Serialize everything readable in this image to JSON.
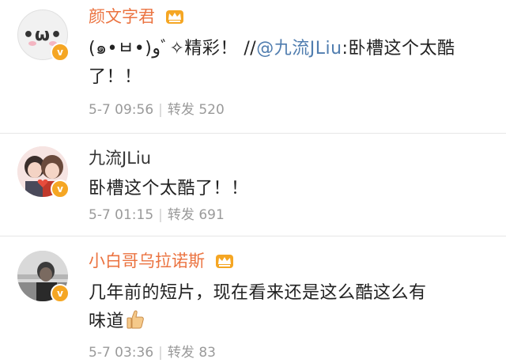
{
  "comments": [
    {
      "username": "颜文字君",
      "text_prefix": "(๑•ㅂ•)وﾞ✧精彩！ //",
      "mention": "@九流JLiu",
      "text_suffix": ":卧槽这个太酷了！！",
      "date": "5-7 09:56",
      "repost_label": "转发",
      "repost_count": "520",
      "avatar_text": "•ω•"
    },
    {
      "username": "九流JLiu",
      "text": "卧槽这个太酷了！！",
      "date": "5-7 01:15",
      "repost_label": "转发",
      "repost_count": "691"
    },
    {
      "username": "小白哥乌拉诺斯",
      "text_line1": "几年前的短片，现在看来还是这么酷这么有",
      "text_line2": "味道",
      "date": "5-7 03:36",
      "repost_label": "转发",
      "repost_count": "83"
    }
  ],
  "badge_letter": "v",
  "colors": {
    "username_vip": "#eb7340",
    "username_normal": "#333333",
    "mention": "#507daf",
    "meta": "#9a9a9a",
    "badge": "#f5a623"
  }
}
